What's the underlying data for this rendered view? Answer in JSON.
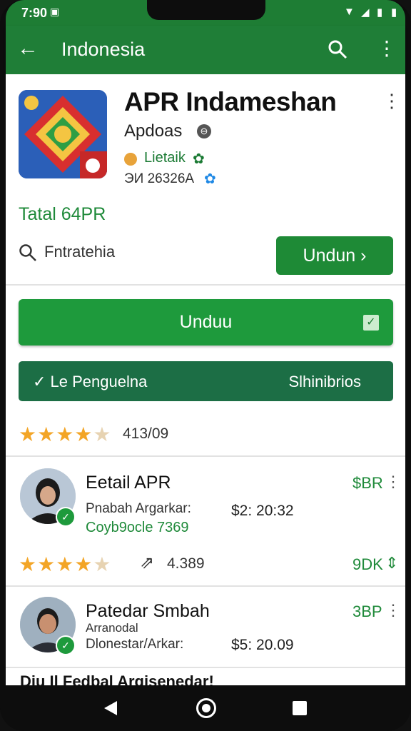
{
  "status_bar": {
    "time": "7:90"
  },
  "app_bar": {
    "title": "Indonesia"
  },
  "app": {
    "title": "APR Indameshan",
    "developer": "Apdoas",
    "badge_label": "Lietaik",
    "meta_line": "ЭИ 26326A"
  },
  "total": "Tatal 64PR",
  "search": {
    "label": "Fntratehia"
  },
  "buttons": {
    "unduh_small": "Undun",
    "unduh_small_arrow": "›",
    "unduh_big": "Unduu"
  },
  "info_bar": {
    "left": "Le Penguelna",
    "right": "Slhinibrios"
  },
  "overall_rating": {
    "value": "413/09",
    "stars": 4
  },
  "reviews": [
    {
      "title": "Eetail APR",
      "subtitle": "Pnabah Argarkar:",
      "green_line": "Coyb9ocle 7369",
      "price": "$2: 20:32",
      "tag": "$BR",
      "stars": 4,
      "rating_text": "4.389",
      "rating_tag": "9DK"
    },
    {
      "title": "Patedar Smbah",
      "subtitle_top": "Arranodal",
      "subtitle": "Dlonestar/Arkar:",
      "price": "$5: 20.09",
      "tag": "3BP"
    }
  ],
  "partial_row": "Diu  Il  Fedbal Argisenedar!",
  "colors": {
    "primary_green": "#1f7e37",
    "button_green": "#1e9a3c",
    "info_bar": "#1c6e45",
    "star": "#f3a526"
  }
}
